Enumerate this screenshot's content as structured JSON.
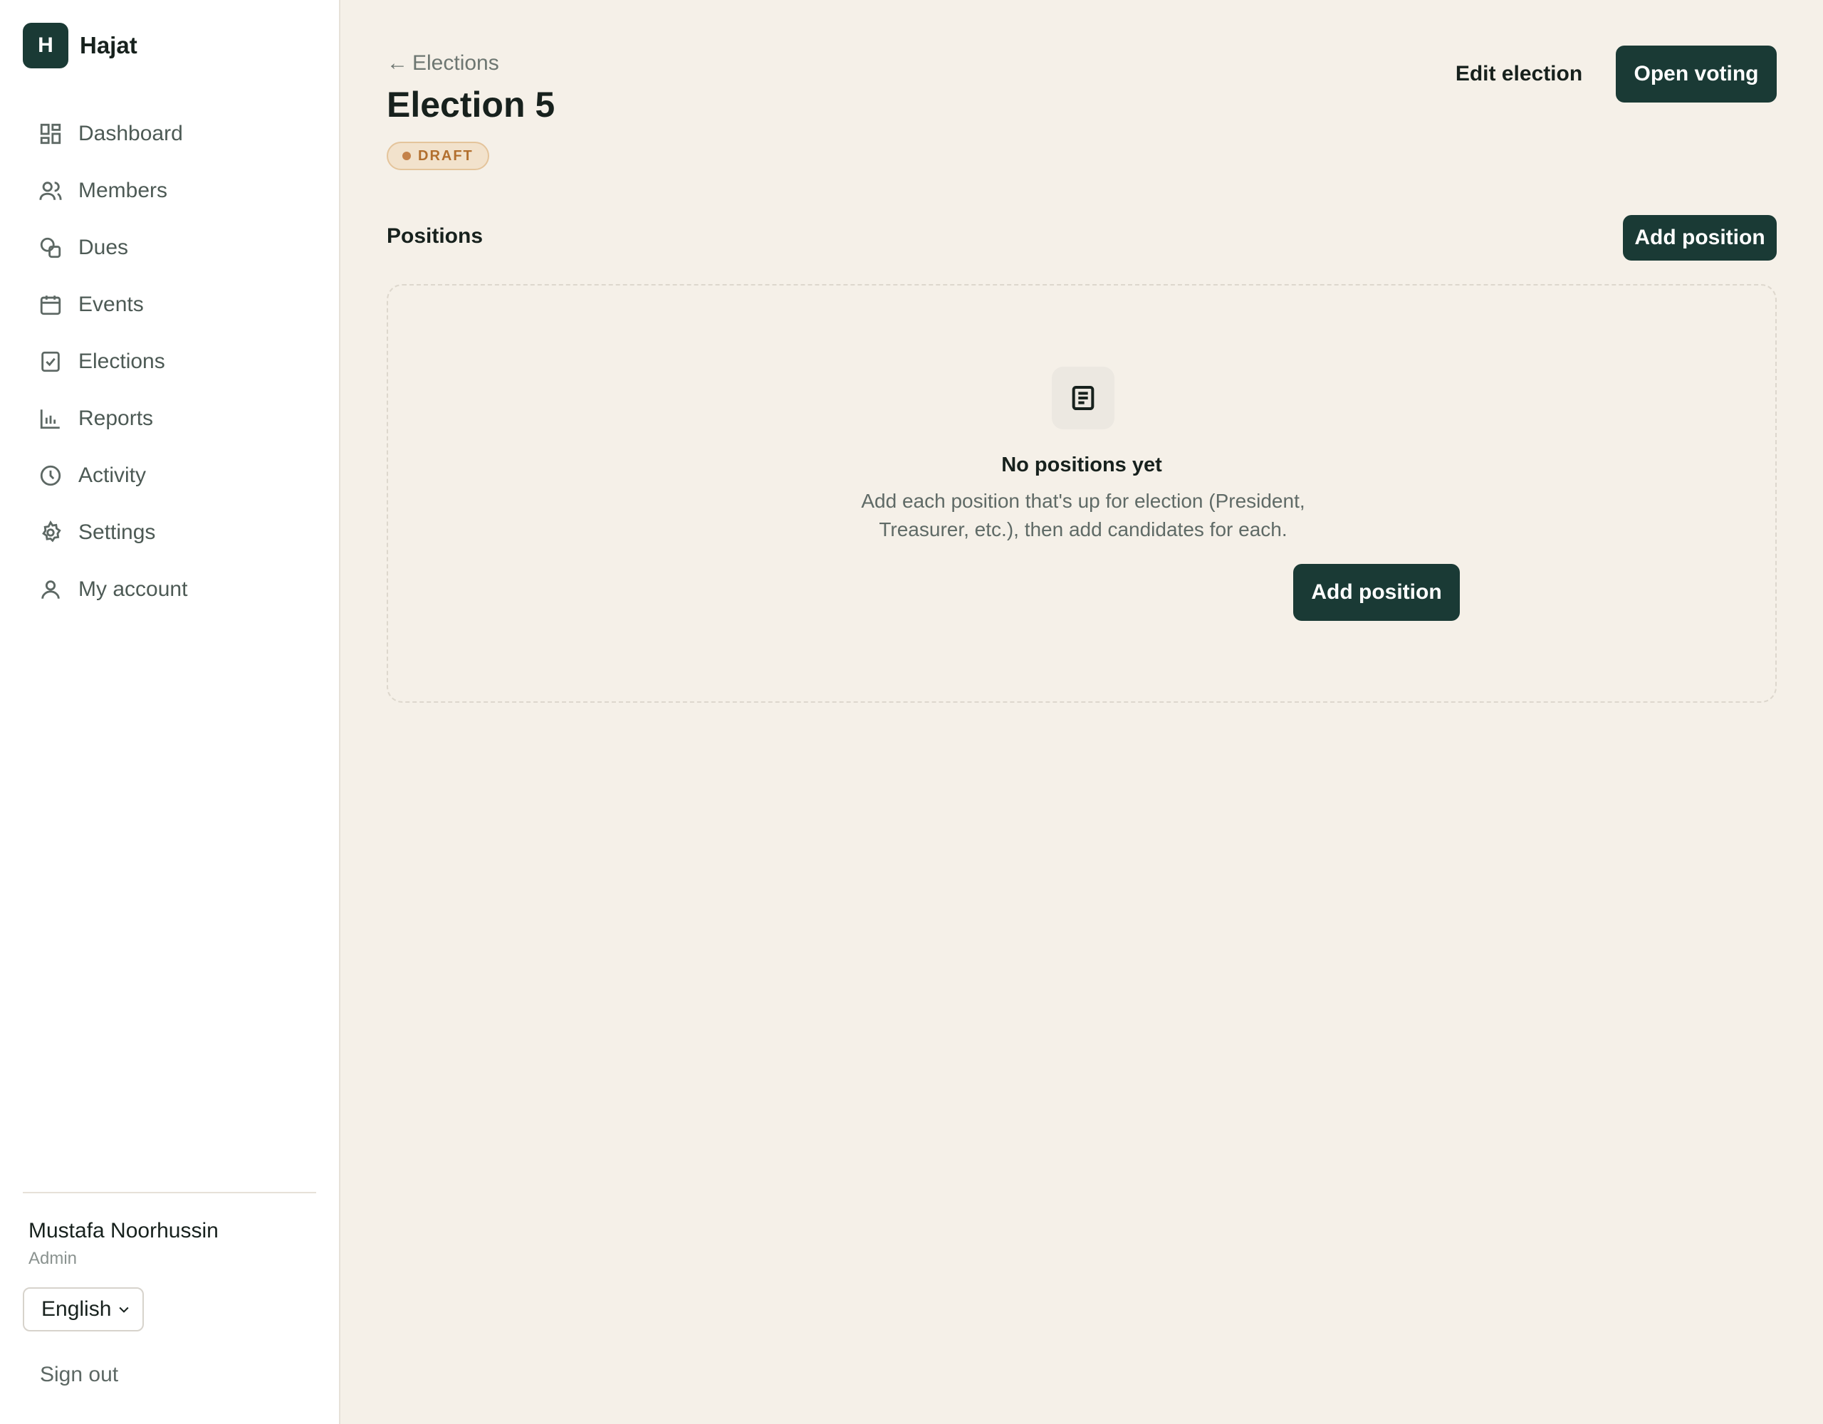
{
  "brand": {
    "initial": "H",
    "name": "Hajat"
  },
  "sidebar": {
    "items": [
      {
        "label": "Dashboard",
        "icon": "dashboard-icon"
      },
      {
        "label": "Members",
        "icon": "members-icon"
      },
      {
        "label": "Dues",
        "icon": "dues-icon"
      },
      {
        "label": "Events",
        "icon": "calendar-icon"
      },
      {
        "label": "Elections",
        "icon": "ballot-check-icon"
      },
      {
        "label": "Reports",
        "icon": "bar-chart-icon"
      },
      {
        "label": "Activity",
        "icon": "clock-icon"
      },
      {
        "label": "Settings",
        "icon": "gear-icon"
      },
      {
        "label": "My account",
        "icon": "user-icon"
      }
    ]
  },
  "user": {
    "name": "Mustafa Noorhussin",
    "role": "Admin"
  },
  "language": {
    "selected": "English"
  },
  "signout_label": "Sign out",
  "header": {
    "back_label": "Elections",
    "title": "Election 5",
    "status": "DRAFT",
    "edit_label": "Edit election",
    "open_label": "Open voting"
  },
  "positions": {
    "title": "Positions",
    "add_label": "Add position",
    "empty_title": "No positions yet",
    "empty_desc": "Add each position that's up for election (President, Treasurer, etc.), then add candidates for each.",
    "empty_add_label": "Add position"
  },
  "colors": {
    "accent": "#1a3a35",
    "background": "#f5f0e8",
    "draft": "#b26f2e"
  }
}
